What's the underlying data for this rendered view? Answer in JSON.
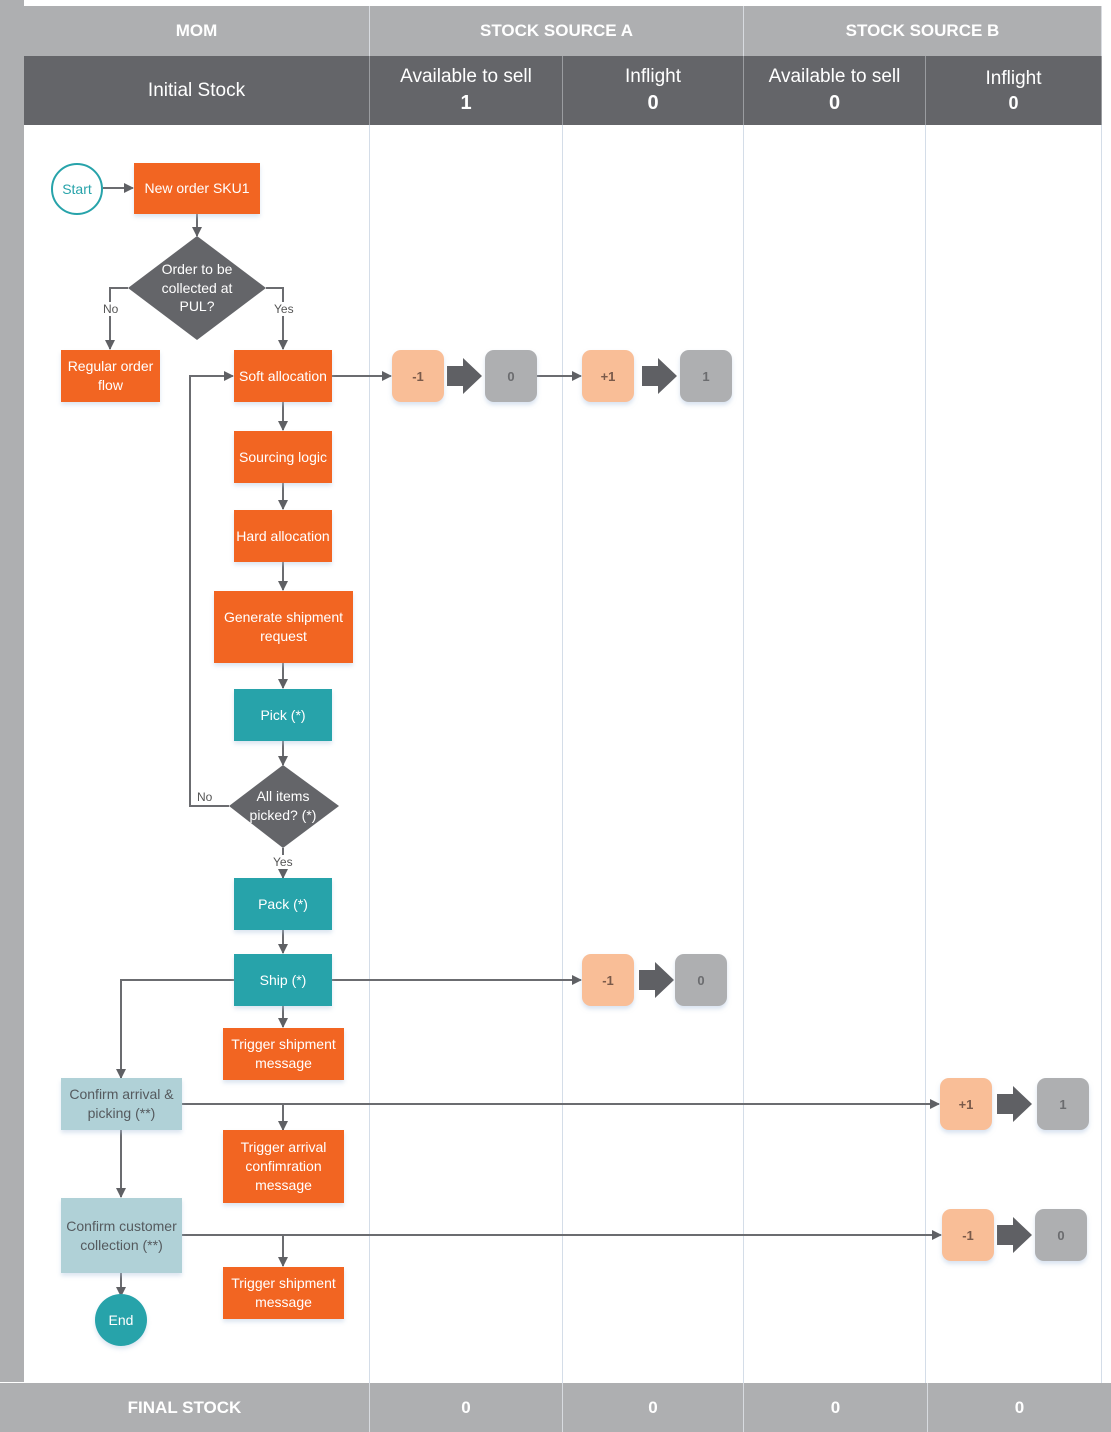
{
  "header": {
    "groups": [
      {
        "label": "MOM"
      },
      {
        "label": "STOCK SOURCE A"
      },
      {
        "label": "STOCK SOURCE B"
      }
    ],
    "initial_stock_label": "Initial Stock",
    "columns": [
      {
        "label": "Available to sell",
        "value": "1"
      },
      {
        "label": "Inflight",
        "value": "0"
      },
      {
        "label": "Available to sell",
        "value": "0"
      },
      {
        "label": "Inflight",
        "value": "0"
      }
    ]
  },
  "footer": {
    "label": "FINAL STOCK",
    "values": [
      "0",
      "0",
      "0",
      "0"
    ]
  },
  "flow": {
    "start": "Start",
    "new_order": "New order SKU1",
    "decision_pul": "Order to be collected at PUL?",
    "no_label_1": "No",
    "yes_label_1": "Yes",
    "regular_flow": "Regular order flow",
    "soft_allocation": "Soft allocation",
    "sourcing_logic": "Sourcing logic",
    "hard_allocation": "Hard allocation",
    "generate_shipment": "Generate shipment request",
    "pick": "Pick (*)",
    "decision_picked": "All items picked? (*)",
    "no_label_2": "No",
    "yes_label_2": "Yes",
    "pack": "Pack (*)",
    "ship": "Ship (*)",
    "trigger_shipment_1": "Trigger shipment message",
    "confirm_arrival": "Confirm arrival & picking (**)",
    "trigger_arrival": "Trigger arrival confimration message",
    "confirm_collection": "Confirm customer collection (**)",
    "trigger_shipment_2": "Trigger shipment message",
    "end": "End"
  },
  "stock_changes": [
    {
      "step": "soft_allocation",
      "column": "Stock Source A / Available to sell",
      "delta": "-1",
      "result": "0"
    },
    {
      "step": "soft_allocation",
      "column": "Stock Source A / Inflight",
      "delta": "+1",
      "result": "1"
    },
    {
      "step": "ship",
      "column": "Stock Source A / Inflight",
      "delta": "-1",
      "result": "0"
    },
    {
      "step": "confirm_arrival",
      "column": "Stock Source B / Inflight",
      "delta": "+1",
      "result": "1"
    },
    {
      "step": "confirm_collection",
      "column": "Stock Source B / Inflight",
      "delta": "-1",
      "result": "0"
    }
  ],
  "colors": {
    "process_orange": "#f26522",
    "manual_teal": "#27a3aa",
    "store_light": "#b0d1d7",
    "decision_gray": "#646569",
    "header_gray": "#aeafb1",
    "delta_peach": "#f9be97"
  }
}
